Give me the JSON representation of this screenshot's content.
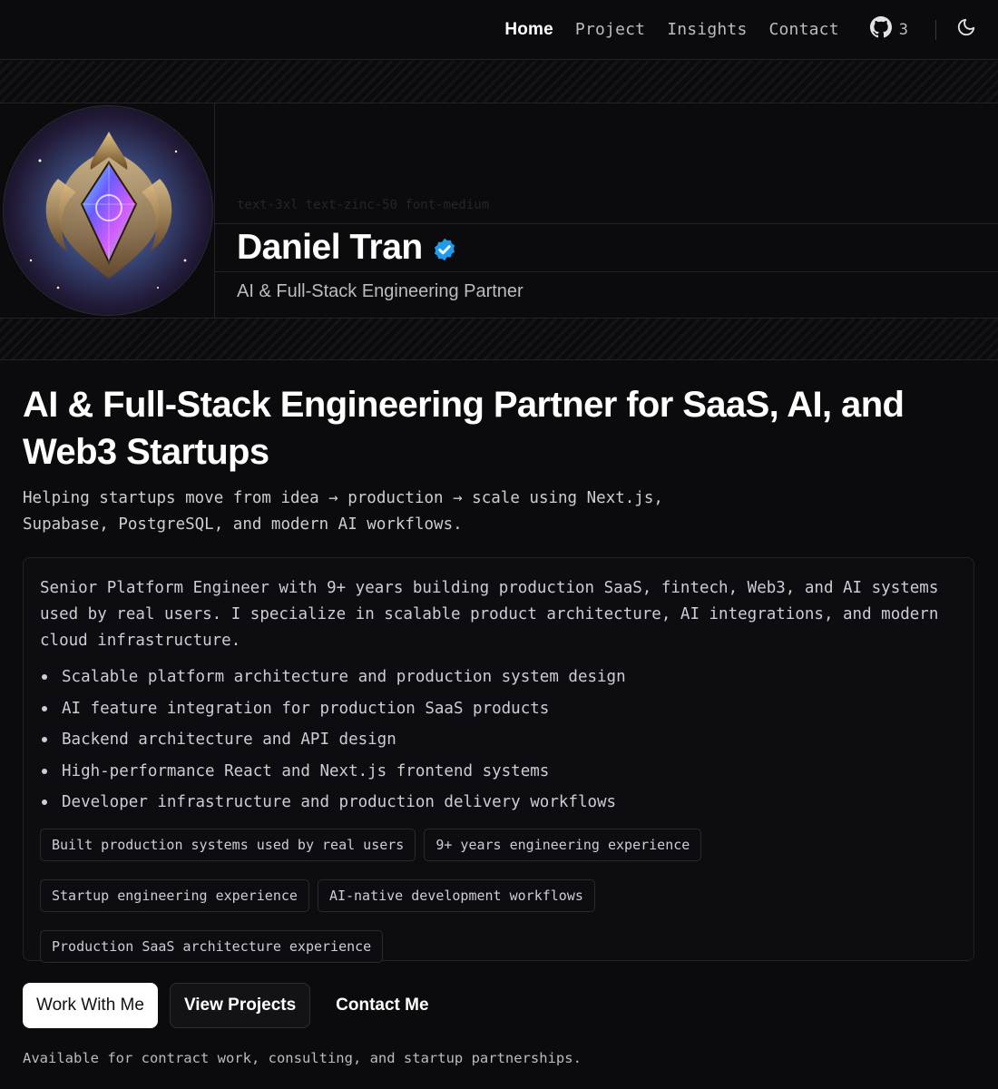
{
  "nav": {
    "links": [
      {
        "label": "Home",
        "active": true
      },
      {
        "label": "Project",
        "active": false
      },
      {
        "label": "Insights",
        "active": false
      },
      {
        "label": "Contact",
        "active": false
      }
    ],
    "github": {
      "icon": "github-icon",
      "count": "3"
    },
    "theme_toggle_icon": "moon-icon"
  },
  "profile": {
    "avatar_icon": "avatar-crystal-emblem",
    "class_hint": "text-3xl text-zinc-50 font-medium",
    "name": "Daniel Tran",
    "verified_icon": "verified-badge-icon",
    "subtitle": "AI & Full-Stack Engineering Partner"
  },
  "hero": {
    "headline": "AI & Full-Stack Engineering Partner for SaaS, AI, and Web3 Startups",
    "lead": "Helping startups move from idea → production → scale using Next.js, Supabase, PostgreSQL, and modern AI workflows."
  },
  "card": {
    "intro": "Senior Platform Engineer with 9+ years building production SaaS, fintech, Web3, and AI systems used by real users. I specialize in scalable product architecture, AI integrations, and modern cloud infrastructure.",
    "bullets": [
      "Scalable platform architecture and production system design",
      "AI feature integration for production SaaS products",
      "Backend architecture and API design",
      "High-performance React and Next.js frontend systems",
      "Developer infrastructure and production delivery workflows"
    ],
    "tags": [
      "Built production systems used by real users",
      "9+ years engineering experience",
      "Startup engineering experience",
      "AI-native development workflows",
      "Production SaaS architecture experience"
    ]
  },
  "actions": {
    "primary": "Work With Me",
    "secondary": "View Projects",
    "tertiary": "Contact Me"
  },
  "availability": "Available for contract work, consulting, and startup partnerships.",
  "colors": {
    "background": "#0b0a0d",
    "verified": "#1d9bf0",
    "primary_button": "#ffffff"
  }
}
